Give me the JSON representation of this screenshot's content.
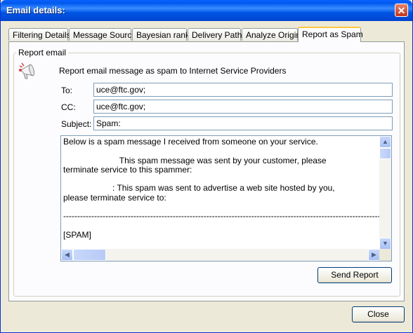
{
  "window": {
    "title": "Email details:"
  },
  "tabs": [
    {
      "label": "Filtering Details",
      "active": false
    },
    {
      "label": "Message Source",
      "active": false
    },
    {
      "label": "Bayesian rank",
      "active": false
    },
    {
      "label": "Delivery Path",
      "active": false
    },
    {
      "label": "Analyze Origin",
      "active": false
    },
    {
      "label": "Report as Spam",
      "active": true
    }
  ],
  "report": {
    "group_label": "Report email",
    "description": "Report email message as spam to Internet Service Providers",
    "to_label": "To:",
    "to_value": "uce@ftc.gov;",
    "cc_label": "CC:",
    "cc_value": "uce@ftc.gov;",
    "subject_label": "Subject:",
    "subject_value": "Spam:",
    "body": "Below is a spam message I received from someone on your service.\n\n                        This spam message was sent by your customer, please\nterminate service to this spammer:\n\n                     : This spam was sent to advertise a web site hosted by you,\nplease terminate service to:\n\n--------------------------------------------------------------------------------------------------------------------\n\n[SPAM]",
    "icon": "megaphone-icon"
  },
  "buttons": {
    "send_report": "Send Report",
    "close": "Close"
  },
  "colors": {
    "titlebar": "#0058ee",
    "active_tab_accent": "#ffc83c",
    "dialog_bg": "#ece9d8"
  }
}
